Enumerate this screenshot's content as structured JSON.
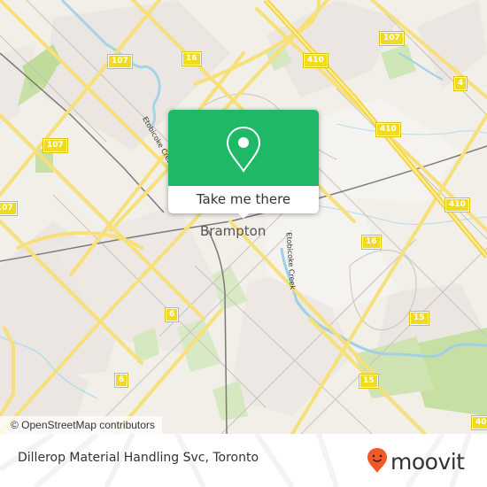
{
  "map": {
    "city_label": "Brampton",
    "street_labels": [
      {
        "name": "etobicoke-creek-north",
        "text": "Etobicoke Creek"
      },
      {
        "name": "etobicoke-creek-south",
        "text": "Etobicoke Creek"
      }
    ],
    "route_shields": [
      {
        "label": "107"
      },
      {
        "label": "16"
      },
      {
        "label": "410"
      },
      {
        "label": "107"
      },
      {
        "label": "4"
      },
      {
        "label": "107"
      },
      {
        "label": "410"
      },
      {
        "label": "107"
      },
      {
        "label": "410"
      },
      {
        "label": "16"
      },
      {
        "label": "6"
      },
      {
        "label": "15"
      },
      {
        "label": "6"
      },
      {
        "label": "15"
      },
      {
        "label": "40"
      }
    ],
    "attribution": "© OpenStreetMap contributors"
  },
  "popup": {
    "icon": "map-pin-icon",
    "button_label": "Take me there",
    "accent_color": "#1fb866"
  },
  "footer": {
    "place_name": "Dillerop Material Handling Svc, Toronto",
    "brand": "moovit",
    "brand_color": "#f05a28"
  }
}
